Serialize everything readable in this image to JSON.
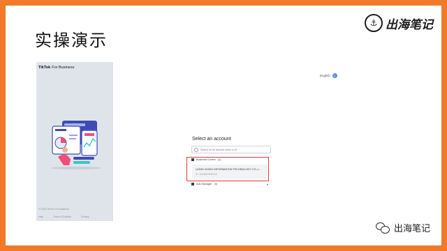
{
  "slide": {
    "title": "实操演示",
    "brand_top": "出海笔记",
    "brand_bottom": "出海笔记"
  },
  "left_panel": {
    "logo": "TikTok",
    "logo_sub": "For Business",
    "copyright": "© 2023 TikTok For Business",
    "links": [
      "Help",
      "Terms & Policies",
      "Privacy"
    ],
    "illustration": "tiktok-business-illustration"
  },
  "header": {
    "language": "English",
    "avatar_initial": "L"
  },
  "account_select": {
    "title": "Select an account",
    "search_placeholder": "Search for an account name or ID",
    "groups": [
      {
        "label": "Business Center",
        "count": "(1)"
      },
      {
        "label": "Ads Manager",
        "count": "(0)"
      }
    ],
    "selected_account": {
      "name": "LIONG XIONG INFORMATION TECHNOLOGY CO.,L...",
      "id": "ID: 1234567890123"
    }
  },
  "colors": {
    "frame": "#f07a2a",
    "highlight": "#e23b3b",
    "panel_bg": "#dfe4ea"
  }
}
